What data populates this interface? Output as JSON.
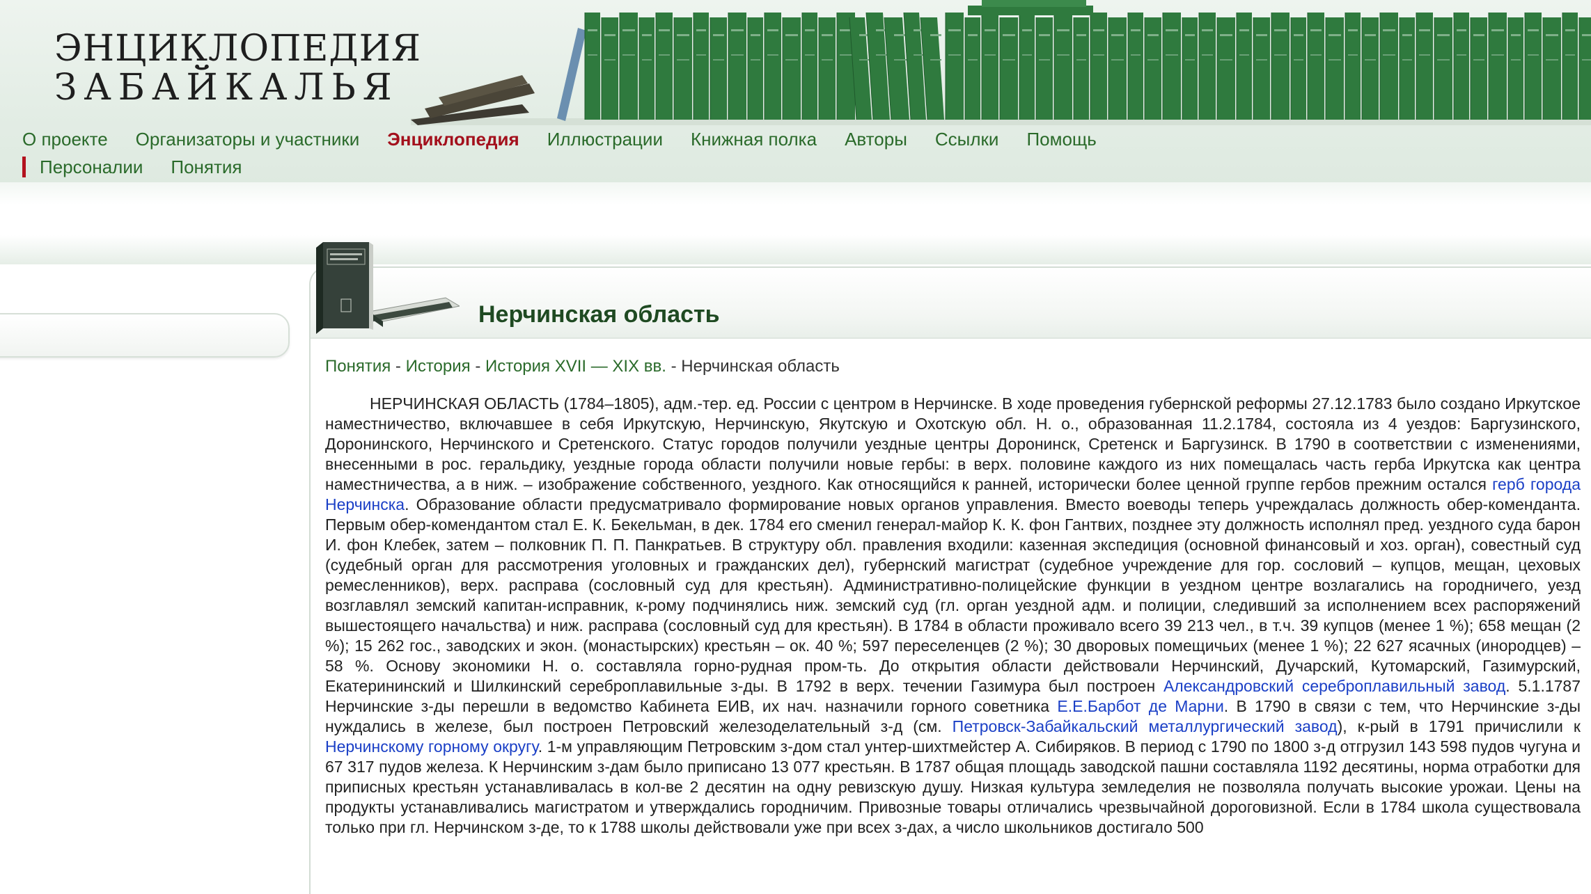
{
  "logo": {
    "line1": "ЭНЦИКЛОПЕДИЯ",
    "line2": "ЗАБАЙКАЛЬЯ"
  },
  "nav": {
    "items": [
      {
        "label": "О проекте"
      },
      {
        "label": "Организаторы и участники"
      },
      {
        "label": "Энциклопедия"
      },
      {
        "label": "Иллюстрации"
      },
      {
        "label": "Книжная полка"
      },
      {
        "label": "Авторы"
      },
      {
        "label": "Ссылки"
      },
      {
        "label": "Помощь"
      }
    ],
    "sub_items": [
      {
        "label": "Персоналии"
      },
      {
        "label": "Понятия"
      }
    ]
  },
  "page": {
    "title": "Нерчинская область"
  },
  "breadcrumb": {
    "items": [
      "Понятия",
      "История",
      "История XVII — XIX вв."
    ],
    "separator": " - ",
    "current": "Нерчинская область"
  },
  "article": {
    "t1": "НЕРЧИНСКАЯ ОБЛАСТЬ (1784–1805), адм.-тер. ед. России с центром в Нерчинске. В ходе проведения губернской реформы 27.12.1783 было создано Иркутское наместничество, включавшее в себя Иркутскую, Нерчинскую, Якутскую и Охотскую обл. Н. о., образованная 11.2.1784, состояла из 4 уездов: Баргузинского, Доронинского, Нерчинского и Сретенского. Статус городов получили уездные центры Доронинск, Сретенск и Баргузинск. В 1790 в соответствии с изменениями, внесенными в рос. геральдику, уездные города области получили новые гербы: в верх. половине каждого из них помещалась часть герба Иркутска как центра наместничества, а в ниж. – изображение собственного, уездного. Как относящийся к ранней, исторически более ценной группе гербов прежним остался ",
    "l1": "герб города Нерчинска",
    "t2": ". Образование области предусматривало формирование новых органов управления. Вместо воеводы теперь учреждалась должность обер-коменданта. Первым обер-комендантом стал Е. К. Бекельман, в дек. 1784 его сменил генерал-майор К. К. фон Гантвих, позднее эту должность исполнял пред. уездного суда барон И. фон Клебек, затем – полковник П. П. Панкратьев. В структуру обл. правления входили: казенная экспедиция (основной финансовый и хоз. орган), совестный суд (судебный орган для рассмотрения уголовных и гражданских дел), губернский магистрат (судебное учреждение для гор. сословий – купцов, мещан, цеховых ремесленников), верх. расправа (сословный суд для крестьян). Административно-полицейские функции в уездном центре возлагались на городничего, уезд возглавлял земский капитан-исправник, к-рому подчинялись ниж. земский суд (гл. орган уездной адм. и полиции, следивший за исполнением всех распоряжений вышестоящего начальства) и ниж. расправа (сословный суд для крестьян). В 1784 в области проживало всего 39 213 чел., в т.ч. 39 купцов (менее 1 %); 658 мещан (2 %); 15 262 гос., заводских и экон. (монастырских) крестьян – ок. 40 %; 597 переселенцев (2 %); 30 дворовых помещичьих (менее 1 %); 22 627 ясачных (инородцев) – 58 %. Основу экономики Н. о. составляла горно-рудная пром-ть. До открытия области действовали Нерчинский, Дучарский, Кутомарский, Газимурский, Екатерининский и Шилкинский сереброплавильные з-ды. В 1792 в верх. течении Газимура был построен ",
    "l2": "Александровский сереброплавильный завод",
    "t3": ". 5.1.1787 Нерчинские з-ды перешли в ведомство Кабинета ЕИВ, их нач. назначили горного советника ",
    "l3": "Е.Е.Барбот де Марни",
    "t4": ". В 1790 в связи с тем, что Нерчинские з-ды нуждались в железе, был построен Петровский железоделательный з-д (см. ",
    "l4": "Петровск-Забайкальский металлургический завод",
    "t5": "), к-рый в 1791 причислили к ",
    "l5": "Нерчинскому горному округу",
    "t6": ". 1-м управляющим Петровским з-дом стал унтер-шихтмейстер А. Сибиряков. В период с 1790 по 1800 з-д отгрузил 143 598 пудов чугуна и 67 317 пудов железа. К Нерчинским з-дам было приписано 13 077 крестьян. В 1787 общая площадь заводской пашни составляла 1192 десятины, норма отработки для приписных крестьян устанавливалась в кол-ве 2 десятин на одну ревизскую душу. Низкая культура земледелия не позволяла получать высокие урожаи. Цены на продукты устанавливались магистратом и утверждались городничим. Привозные товары отличались чрезвычайной дороговизной. Если в 1784 школа существовала только при гл. Нерчинском з-де, то к 1788 школы действовали уже при всех з-дах, а число школьников достигало 500"
  },
  "colors": {
    "nav_link": "#2a6a2a",
    "nav_active": "#a3101c",
    "title": "#1f4a22",
    "article_link": "#1a3fc6",
    "book_green": "#2f7a3e"
  }
}
